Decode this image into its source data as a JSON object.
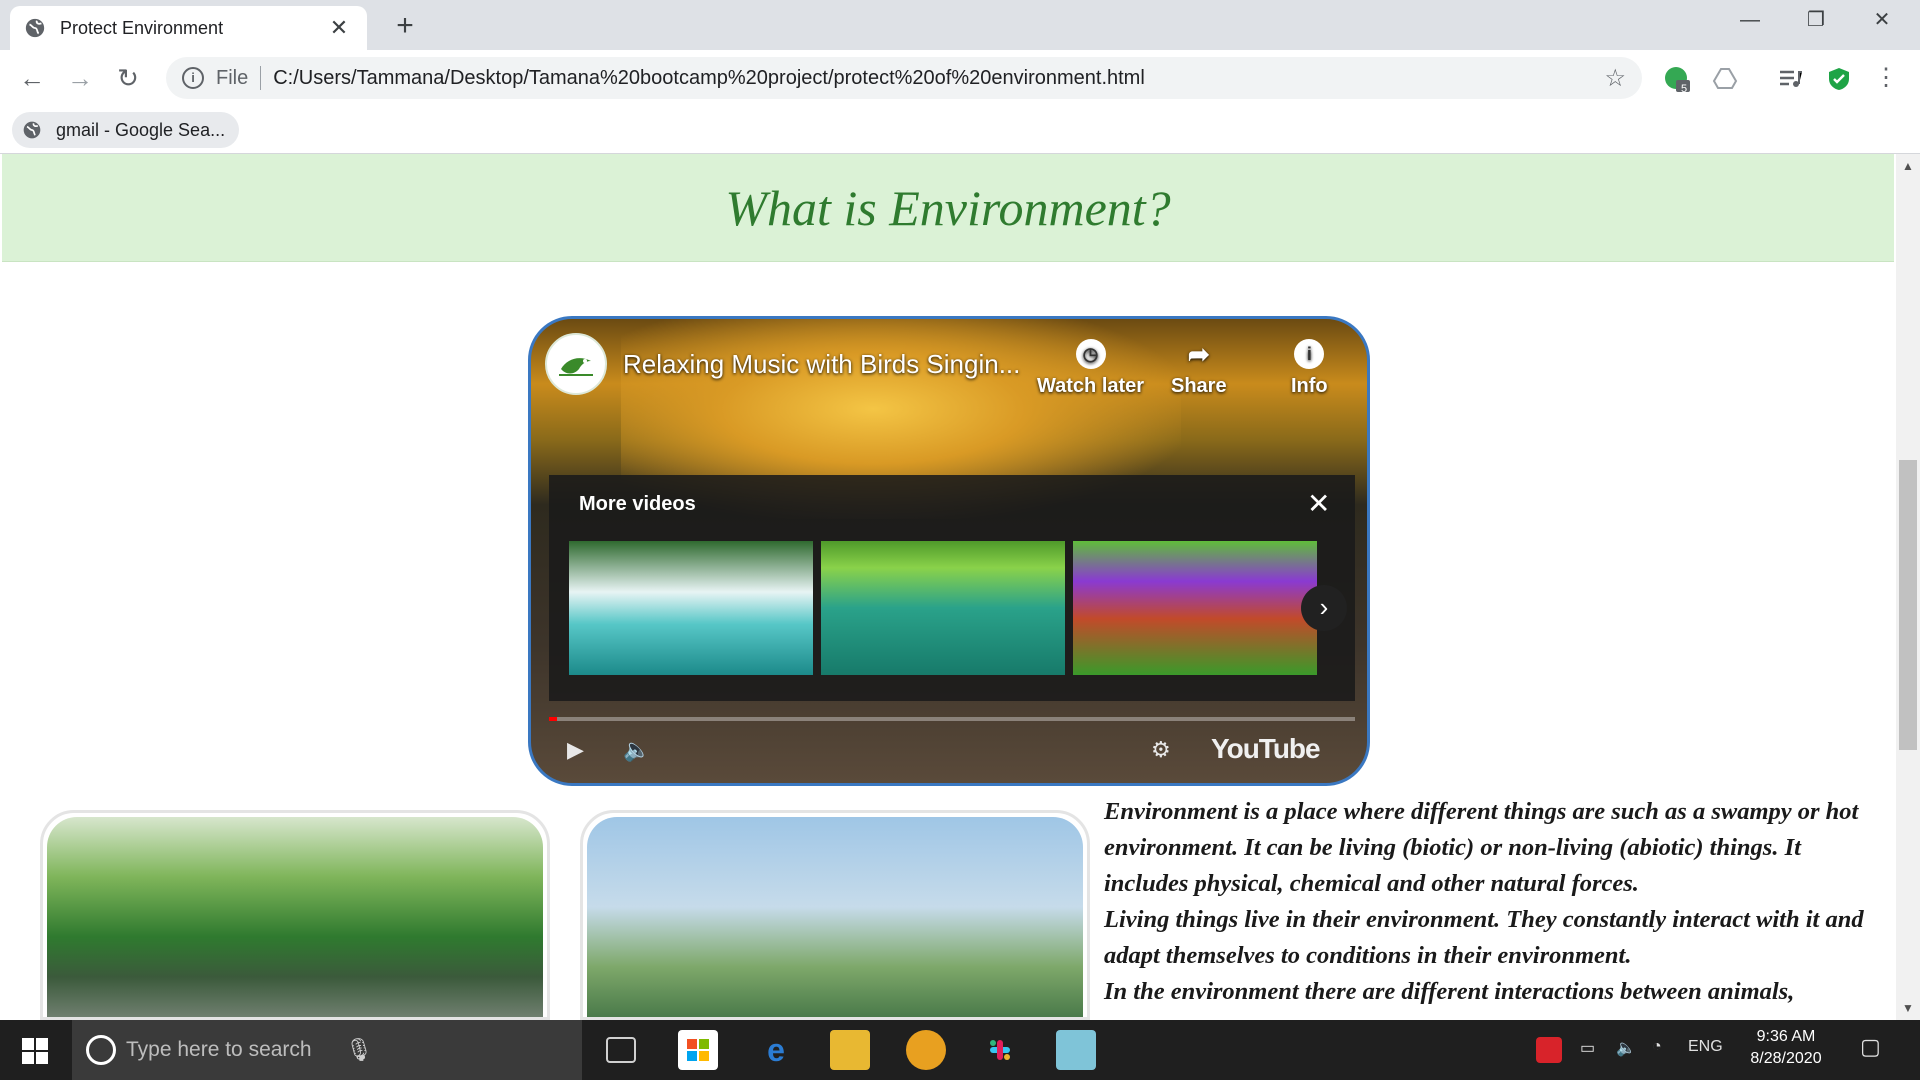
{
  "browser": {
    "tab_title": "Protect Environment",
    "tab_close": "✕",
    "new_tab": "+",
    "window_minimize": "—",
    "window_restore": "❐",
    "window_close": "✕",
    "back": "←",
    "forward": "→",
    "reload": "↻",
    "info_symbol": "i",
    "scheme_label": "File",
    "url": "C:/Users/Tammana/Desktop/Tamana%20bootcamp%20project/protect%20of%20environment.html",
    "bookmark_star": "☆",
    "extension_badge": "5",
    "menu": "⋮",
    "bookmark": "gmail - Google Sea..."
  },
  "page": {
    "heading": "What is Environment?",
    "video": {
      "title": "Relaxing Music with Birds Singin...",
      "watch_later": "Watch later",
      "share": "Share",
      "info": "Info",
      "more_videos": "More videos",
      "more_close": "✕",
      "next": "›",
      "play": "▶",
      "volume": "🔈",
      "settings": "⚙",
      "youtube": "YouTube",
      "progress_fraction": 0.01
    },
    "paragraphs": [
      "Environment is a place where different things are such as a swampy or hot environment. It can be living (biotic) or non-living (abiotic) things. It includes physical, chemical and other natural forces.",
      "Living things live in their environment. They constantly interact with it and adapt themselves to conditions in their environment.",
      "In the environment there are different interactions between animals,"
    ]
  },
  "taskbar": {
    "search_placeholder": "Type here to search",
    "mic": "🎙",
    "language": "ENG",
    "time": "9:36 AM",
    "date": "8/28/2020"
  },
  "colors": {
    "header_band": "#dbf2d6",
    "heading_text": "#2f7b2f",
    "video_border": "#3a78c2",
    "taskbar": "#1f1f1f"
  },
  "icons": [
    "globe-icon",
    "back-arrow-icon",
    "forward-arrow-icon",
    "reload-icon",
    "info-icon",
    "star-icon",
    "extension-icon",
    "shield-icon",
    "menu-icon",
    "windows-start-icon",
    "cortana-icon",
    "microphone-icon",
    "task-view-icon",
    "store-icon",
    "edge-icon",
    "file-explorer-icon",
    "chrome-icon",
    "slack-icon",
    "notepad-icon"
  ]
}
